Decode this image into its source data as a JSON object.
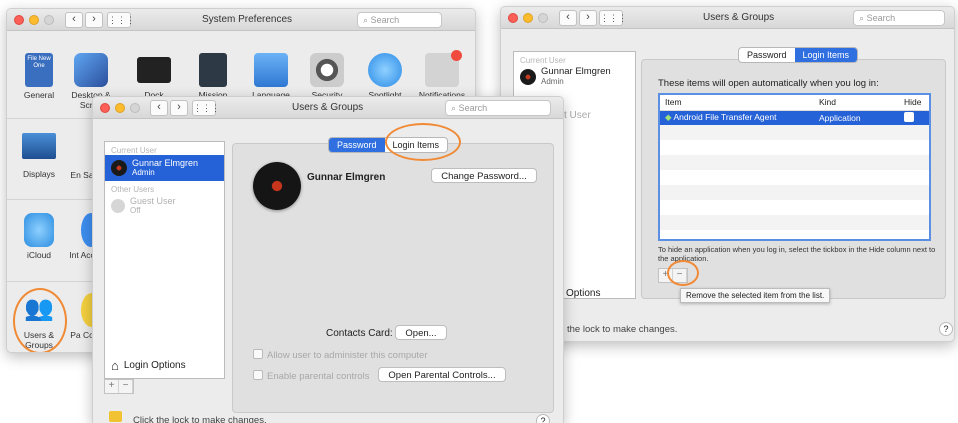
{
  "system_prefs": {
    "title": "System Preferences",
    "search_placeholder": "Search",
    "row1": [
      {
        "label": "General",
        "icon": "general-icon"
      },
      {
        "label": "Desktop & Scree",
        "icon": "desktop-icon"
      },
      {
        "label": "Dock",
        "icon": "dock-icon"
      },
      {
        "label": "Mission",
        "icon": "mission-control-icon"
      },
      {
        "label": "Language",
        "icon": "language-icon"
      },
      {
        "label": "Security",
        "icon": "security-icon"
      },
      {
        "label": "Spotlight",
        "icon": "spotlight-icon"
      },
      {
        "label": "Notifications",
        "icon": "notifications-icon"
      }
    ],
    "general_icon_text": "File New One",
    "left_items": [
      {
        "label": "Displays"
      },
      {
        "label": "En Sa"
      },
      {
        "label": "iCloud"
      },
      {
        "label": "Int Acc"
      },
      {
        "label": "Users & Groups"
      },
      {
        "label": "Pa Co"
      }
    ]
  },
  "users_front": {
    "title": "Users & Groups",
    "search_placeholder": "Search",
    "tabs": [
      "Password",
      "Login Items"
    ],
    "current_user_header": "Current User",
    "current_user_name": "Gunnar Elmgren",
    "current_user_role": "Admin",
    "other_users_header": "Other Users",
    "guest_name": "Guest User",
    "guest_status": "Off",
    "login_options": "Login Options",
    "user_name": "Gunnar Elmgren",
    "change_password": "Change Password...",
    "contacts_card_label": "Contacts Card:",
    "open_button": "Open...",
    "allow_admin": "Allow user to administer this computer",
    "parental": "Enable parental controls",
    "open_parental": "Open Parental Controls...",
    "lock_text": "Click the lock to make changes.",
    "help": "?"
  },
  "users_back": {
    "title": "Users & Groups",
    "search_placeholder": "Search",
    "tabs": [
      "Password",
      "Login Items"
    ],
    "current_user_header": "Current User",
    "current_user_name": "Gunnar Elmgren",
    "current_user_role": "Admin",
    "guest_partial": "st User",
    "options": "Options",
    "login_intro": "These items will open automatically when you log in:",
    "columns": [
      "Item",
      "Kind",
      "Hide"
    ],
    "rows": [
      {
        "item": "Android File Transfer Agent",
        "kind": "Application"
      }
    ],
    "hint": "To hide an application when you log in, select the tickbox in the Hide column next to the application.",
    "tooltip": "Remove the selected item from the list.",
    "lock_text": "the lock to make changes.",
    "help": "?"
  },
  "colors": {
    "accent": "#2662d7",
    "highlight_circle": "#f08a36"
  }
}
